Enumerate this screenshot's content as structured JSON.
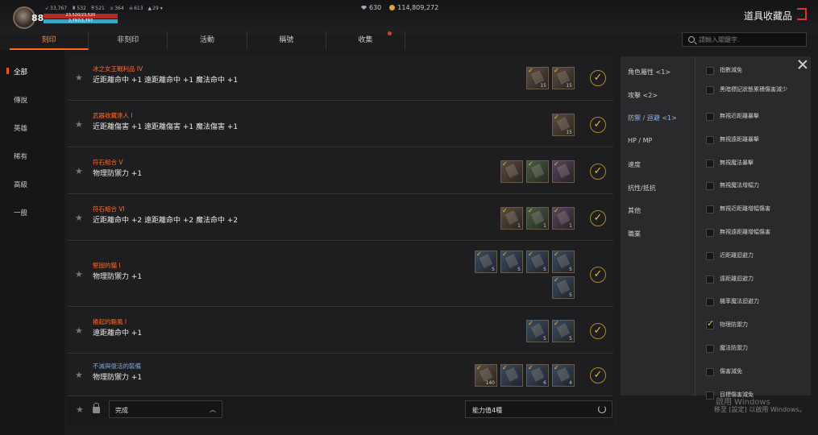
{
  "player": {
    "level": "88",
    "hp_text": "23,520/23,520",
    "mp_text": "2,797/2,797",
    "hp_fraction": 1.0,
    "mp_fraction": 1.0
  },
  "stats": [
    {
      "icon": "wing-icon",
      "value": "33,767"
    },
    {
      "icon": "armor-icon",
      "value": "532"
    },
    {
      "icon": "shield-icon",
      "value": "521"
    },
    {
      "icon": "sword-icon",
      "value": "364"
    },
    {
      "icon": "skull-icon",
      "value": "613"
    },
    {
      "icon": "triforce-icon",
      "value": "29"
    }
  ],
  "currency": {
    "diamond": "630",
    "gold": "114,809,272"
  },
  "header": {
    "title": "道具收藏品"
  },
  "tabs": [
    {
      "label": "刻印",
      "active": true
    },
    {
      "label": "非刻印",
      "active": false
    },
    {
      "label": "活動",
      "active": false
    },
    {
      "label": "稱號",
      "active": false
    },
    {
      "label": "收集",
      "active": false
    }
  ],
  "search": {
    "placeholder": "請輸入關鍵字."
  },
  "nav": [
    {
      "label": "全部",
      "active": true
    },
    {
      "label": "傳說",
      "active": false
    },
    {
      "label": "英雄",
      "active": false
    },
    {
      "label": "稀有",
      "active": false
    },
    {
      "label": "高級",
      "active": false
    },
    {
      "label": "一般",
      "active": false
    }
  ],
  "collections": [
    {
      "name": "冰之女王戰利品 IV",
      "desc": "近距離命中 +1 遠距離命中 +1 魔法命中 +1",
      "color": "orange",
      "items": [
        {
          "count": "15",
          "tone": "brown"
        },
        {
          "count": "15",
          "tone": "brown"
        }
      ]
    },
    {
      "name": "武器收藏達人 I",
      "desc": "近距離傷害 +1 遠距離傷害 +1 魔法傷害 +1",
      "color": "orange",
      "items": [
        {
          "count": "15",
          "tone": "brown"
        }
      ]
    },
    {
      "name": "符石組合 V",
      "desc": "物理防禦力 +1",
      "color": "orange",
      "items": [
        {
          "count": "",
          "tone": "brown"
        },
        {
          "count": "",
          "tone": "green"
        },
        {
          "count": "",
          "tone": "purple"
        }
      ]
    },
    {
      "name": "符石組合 VI",
      "desc": "近距離命中 +2 遠距離命中 +2 魔法命中 +2",
      "color": "orange",
      "items": [
        {
          "count": "1",
          "tone": "brown"
        },
        {
          "count": "1",
          "tone": "green"
        },
        {
          "count": "1",
          "tone": "purple"
        }
      ]
    },
    {
      "name": "堅固的貓 I",
      "desc": "物理防禦力 +1",
      "color": "orange",
      "items": [
        {
          "count": "5",
          "tone": "blue"
        },
        {
          "count": "5",
          "tone": "blue"
        },
        {
          "count": "5",
          "tone": "blue"
        },
        {
          "count": "5",
          "tone": "blue"
        },
        {
          "count": "5",
          "tone": "blue"
        }
      ]
    },
    {
      "name": "捲起的颱風 I",
      "desc": "遠距離命中 +1",
      "color": "orange",
      "items": [
        {
          "count": "5",
          "tone": "blue"
        },
        {
          "count": "5",
          "tone": "blue"
        }
      ]
    },
    {
      "name": "不滅與復活的裝備",
      "desc": "物理防禦力 +1",
      "color": "blue",
      "items": [
        {
          "count": "140",
          "tone": "brown"
        },
        {
          "count": "",
          "tone": "blue"
        },
        {
          "count": "6",
          "tone": "blue"
        },
        {
          "count": "4",
          "tone": "blue"
        }
      ]
    }
  ],
  "footer": {
    "status_select": "完成",
    "effect_label": "能力值4種"
  },
  "filter": {
    "categories": [
      {
        "label": "角色屬性 <1>",
        "active": false
      },
      {
        "label": "攻擊 <2>",
        "active": false
      },
      {
        "label": "防禦 / 迴避 <1>",
        "active": true
      },
      {
        "label": "HP / MP",
        "active": false
      },
      {
        "label": "速度",
        "active": false
      },
      {
        "label": "抗性/抵抗",
        "active": false
      },
      {
        "label": "其他",
        "active": false
      },
      {
        "label": "職業",
        "active": false
      }
    ],
    "options": [
      {
        "label": "指數減免",
        "checked": false
      },
      {
        "label": "黑暗標記狀態累積傷害減少",
        "checked": false
      },
      {
        "label": "無視近距離暴擊",
        "checked": false
      },
      {
        "label": "無視遠距離暴擊",
        "checked": false
      },
      {
        "label": "無視魔法暴擊",
        "checked": false
      },
      {
        "label": "無視魔法增幅力",
        "checked": false
      },
      {
        "label": "無視近距離增幅傷害",
        "checked": false
      },
      {
        "label": "無視遠距離增幅傷害",
        "checked": false
      },
      {
        "label": "近距離迴避力",
        "checked": false
      },
      {
        "label": "遠距離迴避力",
        "checked": false
      },
      {
        "label": "機率魔法迴避力",
        "checked": false
      },
      {
        "label": "物理防禦力",
        "checked": true
      },
      {
        "label": "魔法防禦力",
        "checked": false
      },
      {
        "label": "傷害減免",
        "checked": false
      },
      {
        "label": "目標傷害減免",
        "checked": false
      }
    ]
  },
  "watermark": {
    "line1": "啟用 Windows",
    "line2": "移至 [設定] 以啟用 Windows。"
  },
  "colors": {
    "accent": "#ff6a1a",
    "name_orange": "#ff6a2a",
    "name_blue": "#7aa8d8",
    "check_gold": "#e8b838"
  }
}
